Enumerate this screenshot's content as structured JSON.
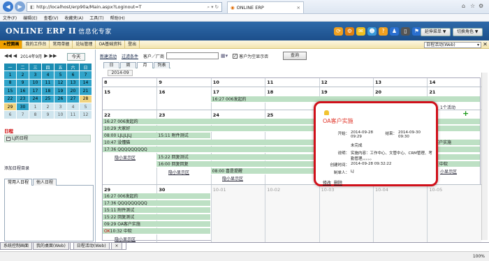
{
  "browser": {
    "url": "http://localhost/erp90a/Main.aspx?Loginout=T",
    "tab_title": "ONLINE ERP",
    "menu": [
      "文件(F)",
      "编辑(E)",
      "查看(V)",
      "收藏夹(A)",
      "工具(T)",
      "帮助(H)"
    ],
    "zoom": "100%"
  },
  "app": {
    "logo": "ONLINE ERP II",
    "logo_cn": "信息化专家",
    "btn_more": "延伸菜单 ▼",
    "btn_switch": "切换角色 ▼",
    "nav": [
      "★控面画",
      "我的工作台",
      "常用单据",
      "论坛管理",
      "OA基础资料",
      "登出"
    ],
    "view_select": "日程活动(Web)"
  },
  "mini_cal": {
    "month_label": "2014年9月",
    "today_btn": "今天",
    "weekdays": [
      "一",
      "二",
      "三",
      "四",
      "五",
      "六",
      "日"
    ],
    "weeks": [
      [
        "1",
        "2",
        "3",
        "4",
        "5",
        "6",
        "7"
      ],
      [
        "8",
        "9",
        "10",
        "11",
        "12",
        "13",
        "14"
      ],
      [
        "15",
        "16",
        "17",
        "18",
        "19",
        "20",
        "21"
      ],
      [
        "22",
        "23",
        "24",
        "25",
        "26",
        "27",
        "28"
      ],
      [
        "29",
        "30",
        "1",
        "2",
        "3",
        "4",
        "5"
      ],
      [
        "6",
        "7",
        "8",
        "9",
        "10",
        "11",
        "12"
      ]
    ]
  },
  "left_panel": {
    "section_title": "日程",
    "my_calendar": "LJ的日程",
    "add_calendar": "添加日程目录",
    "tabs": [
      "常用人日程",
      "他人日程"
    ]
  },
  "toolbar": {
    "new_activity": "新建活动",
    "filter": "过滤条件",
    "customer_label": "客户／厂商",
    "checkbox_label": "客户为空显示否",
    "query": "查询",
    "view_tabs": [
      "日",
      "周",
      "月",
      "列表"
    ],
    "month_label": "2014-09"
  },
  "calendar": {
    "weeks": [
      {
        "days": [
          "8",
          "9",
          "10",
          "11",
          "12",
          "13",
          "14"
        ]
      },
      {
        "days": [
          "15",
          "16",
          "17",
          "18",
          "19",
          "20",
          "21"
        ]
      },
      {
        "days": [
          "22",
          "23",
          "24",
          "25",
          "26",
          "27",
          "28"
        ]
      },
      {
        "days": [
          "29",
          "30",
          "10-01",
          "10-02",
          "10-03",
          "10-04",
          "10-05"
        ]
      }
    ],
    "events": {
      "w2_17": "16:27 006发起的",
      "w3_22": [
        "16:27 006发起的",
        "10:29 大家好",
        "08:00 LJLJLJLJ",
        "10:47 没懂猫",
        "17:36 QQQQQQQQQ"
      ],
      "w3_23": "15:11 附件测试",
      "w3_23b": "15:22 回复测试",
      "w3_23c": "16:00 回复回复",
      "w3_24": "08:00 喜是提醒",
      "w3_28a": "OA客户实施",
      "w3_28b": "中软",
      "w4_29": [
        "16:27 006发起的",
        "17:36 QQQQQQQQQ",
        "15:11 附件测试",
        "15:22 回复测试",
        "09:29 OA客户实施"
      ],
      "w4_29_last_ok": "OK",
      "w4_29_last": "10:32 中软"
    },
    "more_links": {
      "more1": "隐小显示区",
      "more2": "隐小显示区",
      "more3": "隐小显示区",
      "more4": "隐小显示区",
      "more5": "小显示区",
      "more6": "1个活动"
    }
  },
  "popup": {
    "title": "OA客户实施",
    "start_label": "开始：",
    "start_value": "2014-09-28 09:29",
    "end_label": "结束：",
    "end_value": "2014-09-30 09:30",
    "status": "未完成",
    "desc_label": "说明：",
    "desc_value": "实施内容：工作中心、文管中心、CRM管理、考勤管理。。。。。",
    "created_label": "创建时间：",
    "created_value": "2014-09-28 09:32:22",
    "maker_label": "制单人：",
    "maker_value": "LJ",
    "edit": "修改",
    "delete": "删除"
  },
  "bottom_tabs": [
    "系统控制画面",
    "我的桌面(Web)",
    "日程活动(Web)"
  ],
  "colors": {
    "header_blue": "#1c4f8b",
    "nav_active": "#f0a000",
    "event_green": "#bde0c4",
    "popup_border": "#d0101a"
  }
}
